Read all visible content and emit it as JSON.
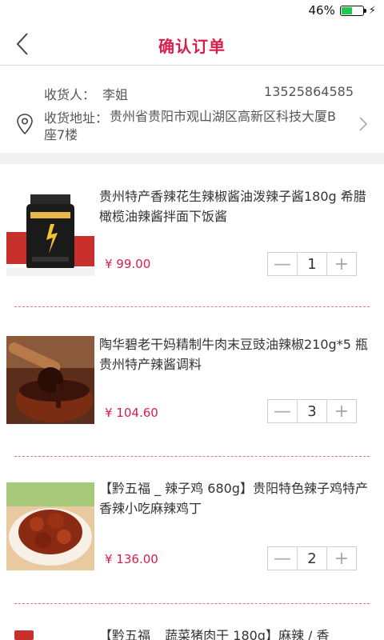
{
  "status": {
    "battery_percent": "46%",
    "battery_level": 0.46,
    "battery_color": "#1fc94c"
  },
  "navbar": {
    "title": "确认订单",
    "accent": "#d81e4a"
  },
  "address": {
    "name_label": "收货人：",
    "name": "李姐",
    "phone": "13525864585",
    "address_label": "收货地址：",
    "address": "贵州省贵阳市观山湖区高新区科技大厦B座7楼"
  },
  "products": [
    {
      "title": "贵州特产香辣花生辣椒酱油泼辣子酱180g 希腊橄榄油辣酱拌面下饭酱",
      "price": "¥ 99.00",
      "qty": "1"
    },
    {
      "title": "陶华碧老干妈精制牛肉末豆豉油辣椒210g*5 瓶贵州特产辣酱调料",
      "price": "¥ 104.60",
      "qty": "3"
    },
    {
      "title": "【黔五福 _ 辣子鸡 680g】贵阳特色辣子鸡特产香辣小吃麻辣鸡丁",
      "price": "¥ 136.00",
      "qty": "2"
    },
    {
      "title": "【黔五福 _ 蔬菜猪肉干 180g】麻辣 / 香"
    }
  ],
  "stepper": {
    "minus": "—",
    "plus": "+"
  }
}
